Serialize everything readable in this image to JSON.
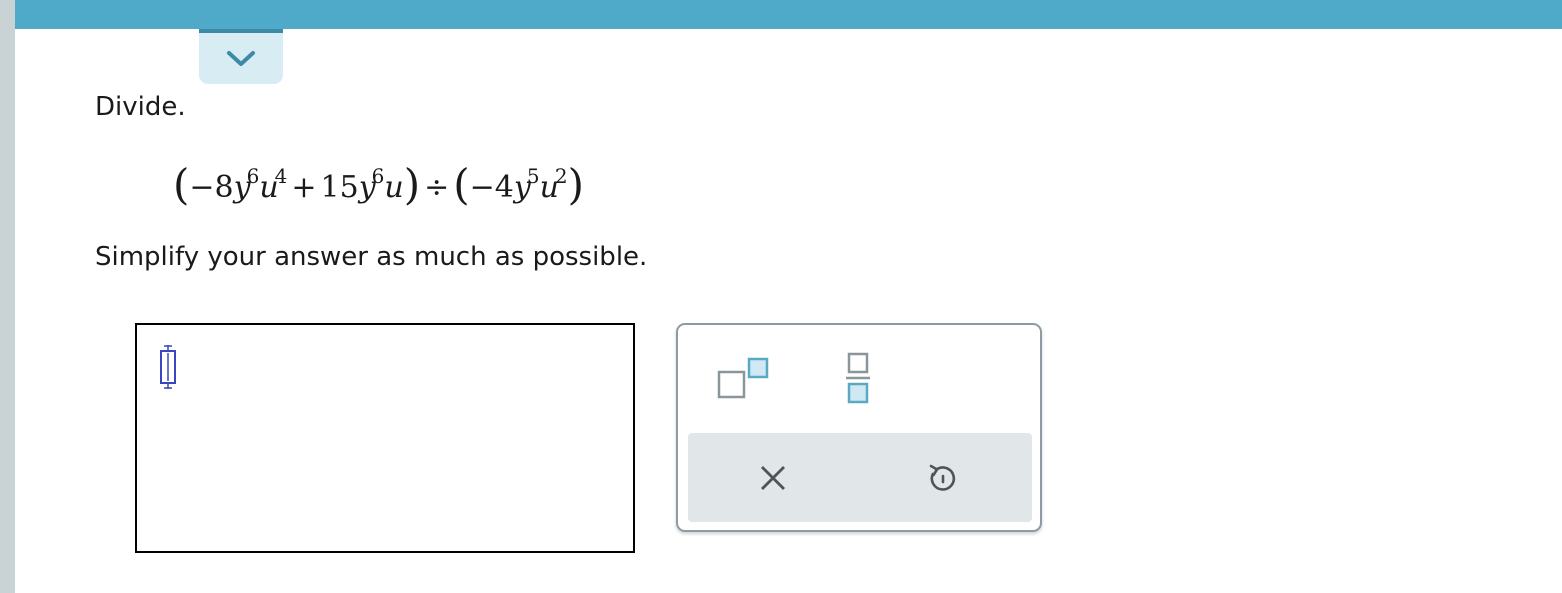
{
  "prompt": "Divide.",
  "expression": {
    "left": {
      "term1": {
        "coef": "−8",
        "var1": "y",
        "exp1": "6",
        "var2": "u",
        "exp2": "4"
      },
      "op": "+",
      "term2": {
        "coef": "15",
        "var1": "y",
        "exp1": "6",
        "var2": "u"
      }
    },
    "divide_sign": "÷",
    "right": {
      "coef": "−4",
      "var1": "y",
      "exp1": "5",
      "var2": "u",
      "exp2": "2"
    },
    "open_paren": "(",
    "close_paren": ")"
  },
  "instruction": "Simplify your answer as much as possible.",
  "answer": {
    "value": ""
  },
  "toolbar": {
    "exponent_icon": "superscript-template-icon",
    "fraction_icon": "fraction-template-icon",
    "clear_icon": "clear-x-icon",
    "undo_icon": "undo-icon"
  },
  "colors": {
    "top_bar": "#4fa9c8",
    "accent": "#3d8aa6",
    "template_box": "#5aa9c4"
  }
}
